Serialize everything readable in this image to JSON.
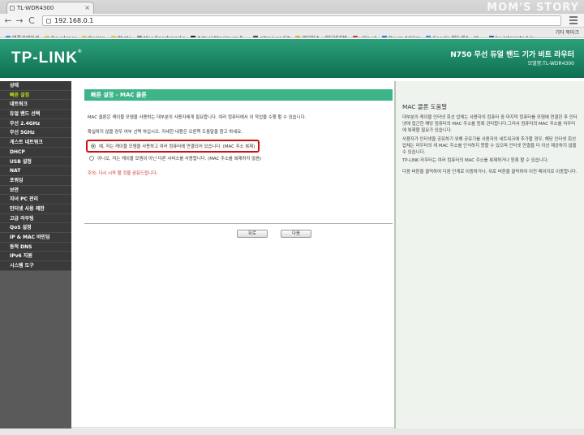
{
  "browser": {
    "tab_title": "TL-WDR4300",
    "tab_close": "×",
    "watermark": "MOM'S STORY",
    "address": "192.168.0.1",
    "back": "←",
    "forward": "→",
    "reload": "C",
    "bookmarks": [
      {
        "label": "애플리케이션",
        "color": "#4a8ad4"
      },
      {
        "label": "Developer",
        "color": "#e8c04a"
      },
      {
        "label": "Design",
        "color": "#e8c04a"
      },
      {
        "label": "Photo",
        "color": "#e8c04a"
      },
      {
        "label": "Mac Benchmarks",
        "color": "#888888"
      },
      {
        "label": "Actual Maximum R...",
        "color": "#222222"
      },
      {
        "label": "gitserver Git",
        "color": "#444444"
      },
      {
        "label": "얼모티스 : 인터넷기반",
        "color": "#e8b020"
      },
      {
        "label": "uCloud",
        "color": "#d04040"
      },
      {
        "label": "Daum Ad@m",
        "color": "#3070d0"
      },
      {
        "label": "Google 애드센스 - 보...",
        "color": "#4a8ad4"
      },
      {
        "label": "be interested in... ..",
        "color": "#3a5fa0"
      }
    ],
    "bookmarks_other": "기타 북마크"
  },
  "router": {
    "logo": "TP-LINK",
    "logo_reg": "®",
    "product_title": "N750 무선 듀얼 밴드 기가 비트 라우터",
    "model": "모델명:TL-WDR4300",
    "sidebar": [
      {
        "label": "상태",
        "active": false
      },
      {
        "label": "빠른 설정",
        "active": true
      },
      {
        "label": "네트워크",
        "active": false
      },
      {
        "label": "듀얼 밴드 선택",
        "active": false
      },
      {
        "label": "무선 2.4GHz",
        "active": false
      },
      {
        "label": "무선 5GHz",
        "active": false
      },
      {
        "label": "게스트 네트워크",
        "active": false
      },
      {
        "label": "DHCP",
        "active": false
      },
      {
        "label": "USB 설정",
        "active": false
      },
      {
        "label": "NAT",
        "active": false
      },
      {
        "label": "포워딩",
        "active": false
      },
      {
        "label": "보안",
        "active": false
      },
      {
        "label": "자녀 PC 관리",
        "active": false
      },
      {
        "label": "인터넷 사용 제한",
        "active": false
      },
      {
        "label": "고급 라우팅",
        "active": false
      },
      {
        "label": "QoS 설정",
        "active": false
      },
      {
        "label": "IP & MAC 바인딩",
        "active": false
      },
      {
        "label": "동적 DNS",
        "active": false
      },
      {
        "label": "IPv6 지원",
        "active": false
      },
      {
        "label": "시스템 도구",
        "active": false
      }
    ],
    "main": {
      "banner": "빠른 설정 - MAC 클론",
      "desc1": "MAC 클론은 케이블 모뎀을 사용하는 대부분의 사용자에게 필요합니다. 여러 컴퓨터에서 이 작업을 수행 할 수 있습니다.",
      "desc2": "확실하지 않을 경우 여부 선택 하십시오. 자세한 내용은 오른쪽 도움말을 참고 하세요.",
      "option_yes": "예, 저는 케이블 모뎀을 사용하고 여러 컴퓨터에 연결되어 있습니다. (MAC 주소 복제)",
      "option_no": "아니오, 저는 케이블 모뎀이 아닌 다른 서비스를 사용합니다. (MAC 주소를 복제하지 않음)",
      "note": "주의: 다시 시작 할 것을 권유드립니다.",
      "back_label": "뒤로",
      "next_label": "다음"
    },
    "help": {
      "title": "MAC 클론 도움말",
      "p1": "대부분의 케이블 인터넷 회선 업체는 사용자의 컴퓨터 중 마지막 컴퓨터를 모뎀에 연결한 후 인터넷에 접근한 해당 컴퓨터의 MAC 주소를 등록 관리합니다.그러서 컴퓨터의 MAC 주소를 라우터에 복제할 필요가 있습니다.",
      "p2": "사용자가 인터넷을 공유하기 위해 공유기를 사용자의 네트워크에 추가할 경우, 해당 인터넷 회선 업체는 라우터의 새 MAC 주소를 인식하지 못할 수 있으며 인터넷 연결을 더 이상 제공하지 않을 수 있습니다.",
      "p3": "TP-LINK 라우터는 여러 컴퓨터의 MAC 주소를 복제하거나 등록 할 수 있습니다.",
      "p4": "다음 버튼을 클릭하여 다음 단계로 이동하거나, 뒤로 버튼을 클릭하여 이전 페이지로 이동합니다."
    }
  }
}
